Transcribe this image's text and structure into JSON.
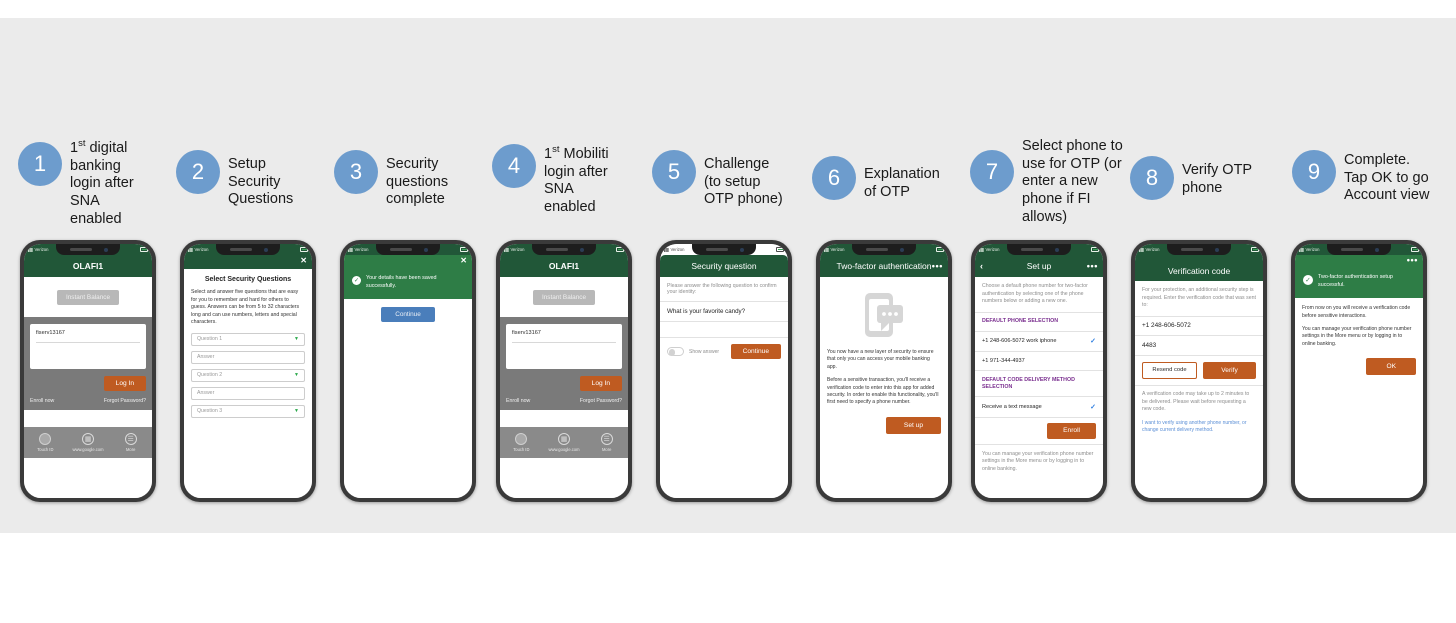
{
  "colors": {
    "band_background": "#ebebeb",
    "step_circle": "#6d9ccd",
    "app_header_green": "#215738",
    "success_green": "#2e7d46",
    "primary_orange": "#bf5b21",
    "continue_blue": "#4a7ebb",
    "section_purple": "#7a2f8f",
    "check_blue": "#2f7fe0"
  },
  "steps": [
    {
      "number": "1",
      "label": "1st digital\nbanking\nlogin after\nSNA\nenabled",
      "sup": "st"
    },
    {
      "number": "2",
      "label": "Setup\nSecurity\nQuestions"
    },
    {
      "number": "3",
      "label": "Security\nquestions\ncomplete"
    },
    {
      "number": "4",
      "label": "1st Mobiliti\nlogin after\nSNA\nenabled",
      "sup": "st"
    },
    {
      "number": "5",
      "label": "Challenge\n(to setup\nOTP phone)"
    },
    {
      "number": "6",
      "label": "Explanation\nof OTP"
    },
    {
      "number": "7",
      "label": "Select phone to\nuse for OTP (or\nenter a new\nphone if FI\nallows)"
    },
    {
      "number": "8",
      "label": "Verify OTP\nphone"
    },
    {
      "number": "9",
      "label": "Complete.\nTap OK to go\nAccount view"
    }
  ],
  "status_bar": {
    "carrier": "Verizon"
  },
  "screen1": {
    "app_title": "OLAFI1",
    "instant_balance": "Instant Balance",
    "username_value": "fiserv13167",
    "password_value": "",
    "login_button": "Log In",
    "enroll_link": "Enroll now",
    "forgot_link": "Forgot Password?",
    "tabs": [
      {
        "label": "Touch ID",
        "icon": "fingerprint-icon"
      },
      {
        "label": "www.google.com",
        "icon": "browser-icon"
      },
      {
        "label": "More",
        "icon": "hamburger-icon"
      }
    ]
  },
  "screen2": {
    "title": "Select Security Questions",
    "description": "Select and answer five questions that are easy for you to remember and hard for others to guess. Answers can be from 5 to 32 characters long and can use numbers, letters and special characters.",
    "fields": [
      {
        "placeholder": "Question 1",
        "type": "select"
      },
      {
        "placeholder": "Answer",
        "type": "text"
      },
      {
        "placeholder": "Question 2",
        "type": "select"
      },
      {
        "placeholder": "Answer",
        "type": "text"
      },
      {
        "placeholder": "Question 3",
        "type": "select"
      }
    ],
    "close_label": "✕"
  },
  "screen3": {
    "message": "Your details have been saved successfully.",
    "continue_button": "Continue",
    "close_label": "✕"
  },
  "screen4": {
    "app_title": "OLAFI1",
    "instant_balance": "Instant Balance",
    "username_value": "fiserv13167",
    "login_button": "Log In",
    "enroll_link": "Enroll now",
    "forgot_link": "Forgot Password?",
    "tabs": [
      {
        "label": "Touch ID"
      },
      {
        "label": "www.google.com"
      },
      {
        "label": "More"
      }
    ]
  },
  "screen5": {
    "title": "Security question",
    "prompt": "Please answer the following question to confirm your identity:",
    "question": "What is your favorite candy?",
    "answer_value": "",
    "show_answer_label": "Show answer",
    "continue_button": "Continue"
  },
  "screen6": {
    "title": "Two-factor authentication",
    "menu_label": "•••",
    "paragraph1": "You now have a new layer of security to ensure that only you can access your mobile banking app.",
    "paragraph2": "Before a sensitive transaction, you'll receive a verification code to enter into this app for added security. In order to enable this functionality, you'll first need to specify a phone number.",
    "setup_button": "Set up",
    "illustration": "phone-chat-icon"
  },
  "screen7": {
    "title": "Set up",
    "back_label": "‹",
    "menu_label": "•••",
    "description": "Choose a default phone number for two-factor authentication by selecting one of the phone numbers below or adding a new one.",
    "phone_section_header": "DEFAULT PHONE SELECTION",
    "phones": [
      {
        "label": "+1 248-606-5072 work iphone",
        "selected": true
      },
      {
        "label": "+1 971-344-4937",
        "selected": false
      }
    ],
    "delivery_section_header": "DEFAULT CODE DELIVERY METHOD SELECTION",
    "delivery_methods": [
      {
        "label": "Receive a text message",
        "selected": true
      }
    ],
    "enroll_button": "Enroll",
    "footer_note": "You can manage your verification phone number settings in the More menu or by logging in to online banking."
  },
  "screen8": {
    "title": "Verification code",
    "description": "For your protection, an additional security step is required. Enter the verification code that was sent to:",
    "phone_number": "+1 248-606-5072",
    "code_value": "4483",
    "resend_button": "Resend code",
    "verify_button": "Verify",
    "note": "A verification code may take up to 2 minutes to be delivered. Please wait before requesting a new code.",
    "alt_link": "I want to verify using another phone number, or change current delivery method."
  },
  "screen9": {
    "menu_label": "•••",
    "success_message": "Two-factor authentication setup successful.",
    "paragraph1": "From now on you will receive a verification code before sensitive interactions.",
    "paragraph2": "You can manage your verification phone number settings in the More menu or by logging in to online banking.",
    "ok_button": "OK"
  }
}
